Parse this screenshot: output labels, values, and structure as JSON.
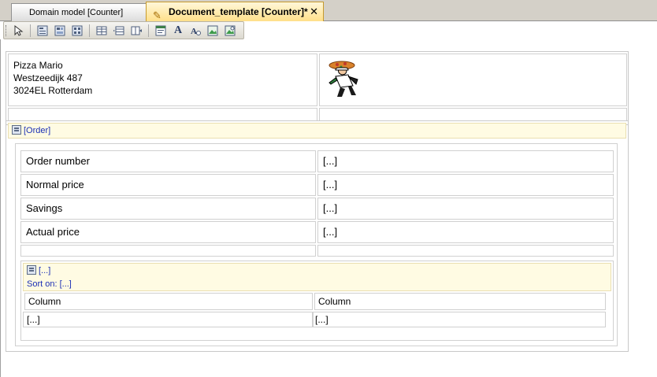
{
  "tabs": [
    {
      "label": "Domain model [Counter]"
    },
    {
      "label": "Document_template [Counter]*"
    }
  ],
  "address": {
    "line1": "Pizza Mario",
    "line2": "Westzeedijk 487",
    "line3": "3024EL Rotterdam"
  },
  "order": {
    "header": "[Order]",
    "rows": [
      {
        "label": "Order number",
        "value": "[...]"
      },
      {
        "label": "Normal price",
        "value": "[...]"
      },
      {
        "label": "Savings",
        "value": "[...]"
      },
      {
        "label": "Actual price",
        "value": "[...]"
      }
    ]
  },
  "grid": {
    "header": "[...]",
    "sort": "Sort on: [...]",
    "columns": [
      "Column",
      "Column"
    ],
    "cells": [
      "[...]",
      "[...]"
    ]
  },
  "icons": {
    "toolbar": [
      "select-arrow-icon",
      "data-view-icon",
      "data-grid-icon",
      "template-grid-icon",
      "table-icon",
      "table-row-icon",
      "column-icon",
      "title-icon",
      "static-label-icon",
      "dynamic-label-icon",
      "static-image-icon",
      "dynamic-image-icon"
    ]
  }
}
